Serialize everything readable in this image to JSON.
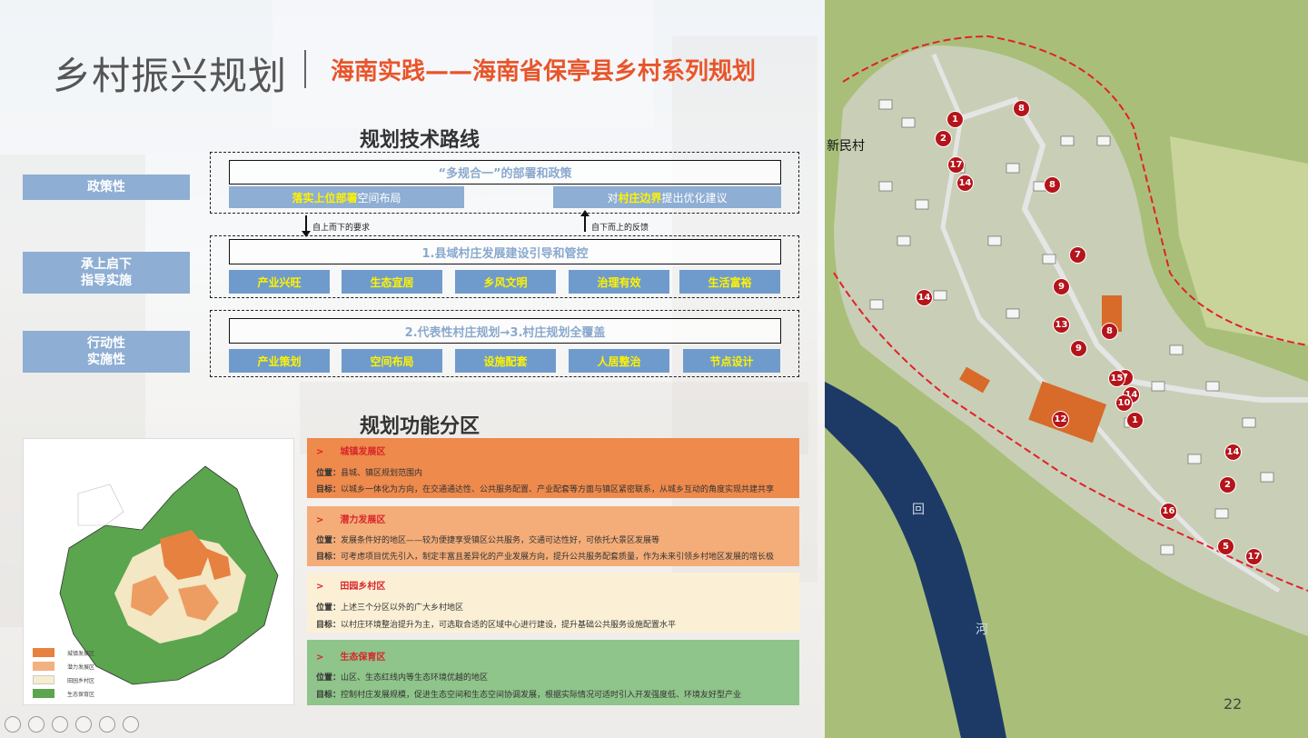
{
  "header": {
    "title": "乡村振兴规划",
    "subtitle": "海南实践——海南省保亭县乡村系列规划"
  },
  "tech_route": {
    "heading": "规划技术路线",
    "side_labels": [
      "政策性",
      "承上启下\n指导实施",
      "行动性\n实施性"
    ],
    "row1": {
      "top_bar": "“多规合一”的部署和政策",
      "left_bar_bold": "落实上位部署",
      "left_bar_rest": "空间布局",
      "right_bar_pre": "对",
      "right_bar_bold": "村庄边界",
      "right_bar_rest": "提出优化建议"
    },
    "arrow_down_text": "自上而下的要求",
    "arrow_up_text": "自下而上的反馈",
    "row2": {
      "top_bar": "1.县域村庄发展建设引导和管控",
      "pills": [
        "产业兴旺",
        "生态宜居",
        "乡风文明",
        "治理有效",
        "生活富裕"
      ]
    },
    "row3": {
      "top_bar": "2.代表性村庄规划→3.村庄规划全覆盖",
      "pills": [
        "产业策划",
        "空间布局",
        "设施配套",
        "人居整治",
        "节点设计"
      ]
    }
  },
  "function_zones": {
    "heading": "规划功能分区",
    "map_legend": [
      "城镇发展区",
      "潜力发展区",
      "田园乡村区",
      "生态保育区"
    ],
    "cards": [
      {
        "title": "城镇发展区",
        "color": "#ee8a4c",
        "lines": [
          {
            "k": "位置：",
            "v": "县城、镇区规划范围内"
          },
          {
            "k": "目标：",
            "v": "以城乡一体化为方向，在交通通达性、公共服务配置、产业配套等方面与镇区紧密联系，从城乡互动的角度实现共建共享"
          }
        ]
      },
      {
        "title": "潜力发展区",
        "color": "#f4ad78",
        "lines": [
          {
            "k": "位置：",
            "v": "发展条件好的地区——较为便捷享受镇区公共服务，交通可达性好，可依托大景区发展等"
          },
          {
            "k": "目标：",
            "v": "可考虑项目优先引入，制定丰富且差异化的产业发展方向，提升公共服务配套质量，作为未来引领乡村地区发展的增长极"
          }
        ]
      },
      {
        "title": "田园乡村区",
        "color": "#fbf0d6",
        "lines": [
          {
            "k": "位置：",
            "v": "上述三个分区以外的广大乡村地区"
          },
          {
            "k": "目标：",
            "v": "以村庄环境整治提升为主，可选取合适的区域中心进行建设，提升基础公共服务设施配置水平"
          }
        ]
      },
      {
        "title": "生态保育区",
        "color": "#8fc48a",
        "lines": [
          {
            "k": "位置：",
            "v": "山区、生态红线内等生态环境优越的地区"
          },
          {
            "k": "目标：",
            "v": "控制村庄发展规模，促进生态空间和生态空间协调发展，根据实际情况可适时引入开发强度低、环境友好型产业"
          }
        ]
      }
    ]
  },
  "site_map": {
    "village_label": "新民村",
    "river_chars": [
      "回",
      "河"
    ],
    "markers": [
      "1",
      "2",
      "17",
      "14",
      "8",
      "8",
      "8",
      "7",
      "9",
      "14",
      "13",
      "9",
      "7",
      "15",
      "14",
      "10",
      "1",
      "12",
      "14",
      "2",
      "16",
      "5",
      "17"
    ]
  },
  "page_number": "22",
  "colors": {
    "accent_title": "#e8552a",
    "label_blue": "#8eaed3",
    "pill_text": "#fff200",
    "zone_red": "#d9252a"
  }
}
